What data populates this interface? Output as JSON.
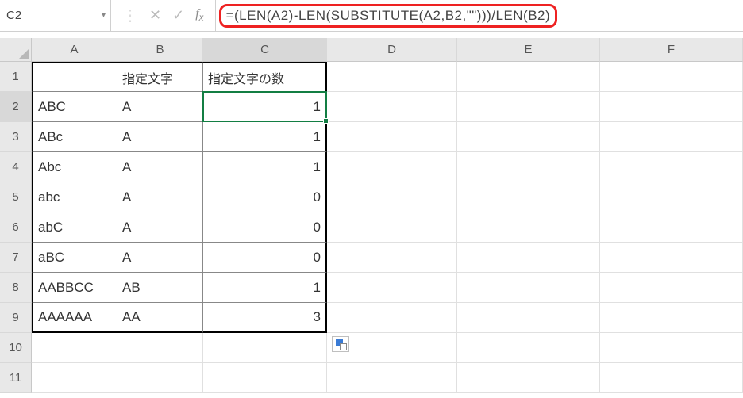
{
  "formulaBar": {
    "nameBox": "C2",
    "formula": "=(LEN(A2)-LEN(SUBSTITUTE(A2,B2,\"\")))/LEN(B2)"
  },
  "columns": [
    "A",
    "B",
    "C",
    "D",
    "E",
    "F"
  ],
  "rowCount": 11,
  "headers": {
    "A": "",
    "B": "指定文字",
    "C": "指定文字の数"
  },
  "rows": [
    {
      "A": "ABC",
      "B": "A",
      "C": "1"
    },
    {
      "A": "ABc",
      "B": "A",
      "C": "1"
    },
    {
      "A": "Abc",
      "B": "A",
      "C": "1"
    },
    {
      "A": "abc",
      "B": "A",
      "C": "0"
    },
    {
      "A": "abC",
      "B": "A",
      "C": "0"
    },
    {
      "A": "aBC",
      "B": "A",
      "C": "0"
    },
    {
      "A": "AABBCC",
      "B": "AB",
      "C": "1"
    },
    {
      "A": "AAAAAA",
      "B": "AA",
      "C": "3"
    }
  ],
  "active": {
    "col": "C",
    "row": 2
  }
}
